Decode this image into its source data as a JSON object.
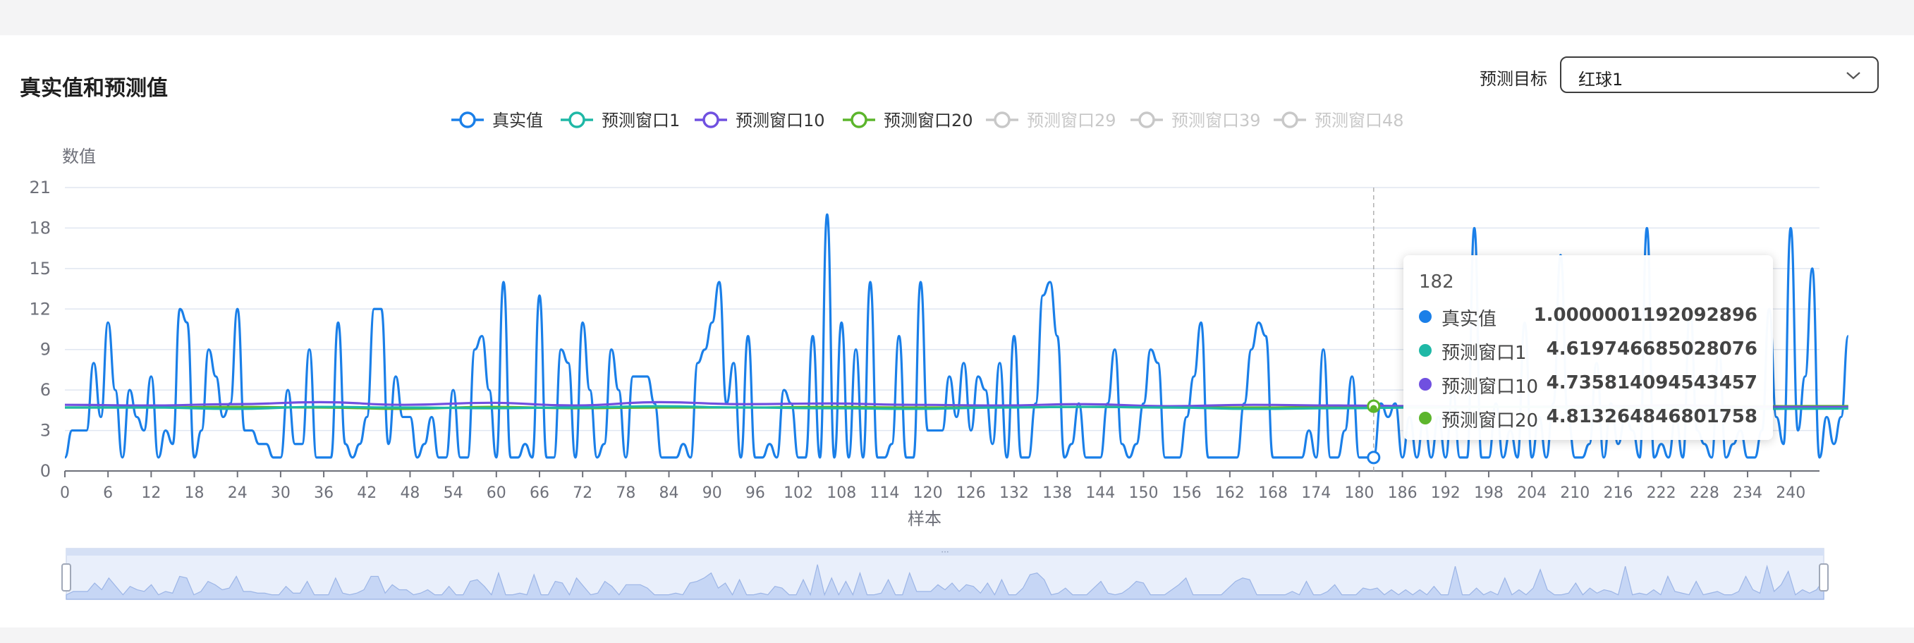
{
  "panel": {
    "title": "真实值和预测值",
    "target_label": "预测目标",
    "target_value": "红球1"
  },
  "tooltip": {
    "header": "182",
    "rows": [
      {
        "name": "真实值",
        "value": "1.0000001192092896",
        "color": "#1a7fe8"
      },
      {
        "name": "预测窗口1",
        "value": "4.619746685028076",
        "color": "#1fb8a6"
      },
      {
        "name": "预测窗口10",
        "value": "4.735814094543457",
        "color": "#7050e0"
      },
      {
        "name": "预测窗口20",
        "value": "4.813264846801758",
        "color": "#5cb52c"
      }
    ]
  },
  "chart_data": {
    "type": "line",
    "xlabel": "样本",
    "ylabel": "数值",
    "ylim": [
      0,
      21
    ],
    "yticks": [
      0,
      3,
      6,
      9,
      12,
      15,
      18,
      21
    ],
    "xlim": [
      0,
      244
    ],
    "xticks": [
      0,
      6,
      12,
      18,
      24,
      30,
      36,
      42,
      48,
      54,
      60,
      66,
      72,
      78,
      84,
      90,
      96,
      102,
      108,
      114,
      120,
      126,
      132,
      138,
      144,
      150,
      156,
      162,
      168,
      174,
      180,
      186,
      192,
      198,
      204,
      210,
      216,
      222,
      228,
      234,
      240
    ],
    "grid": true,
    "legend_position": "top",
    "hover_index": 182,
    "series": [
      {
        "name": "真实值",
        "color": "#1a7fe8",
        "visible": true,
        "values": [
          1,
          3,
          3,
          3,
          8,
          4,
          11,
          6,
          1,
          6,
          4,
          3,
          7,
          1,
          3,
          2,
          12,
          11,
          1,
          3,
          9,
          7,
          4,
          5,
          12,
          3,
          3,
          2,
          2,
          1,
          1,
          6,
          2,
          2,
          9,
          1,
          1,
          1,
          11,
          2,
          1,
          2,
          4,
          12,
          12,
          2,
          7,
          4,
          4,
          1,
          2,
          4,
          1,
          1,
          6,
          1,
          1,
          9,
          10,
          6,
          1,
          14,
          1,
          1,
          2,
          1,
          13,
          1,
          1,
          9,
          8,
          1,
          11,
          6,
          1,
          2,
          9,
          6,
          1,
          7,
          7,
          7,
          5,
          1,
          1,
          1,
          2,
          1,
          8,
          9,
          11,
          14,
          5,
          8,
          1,
          10,
          1,
          1,
          2,
          1,
          6,
          5,
          1,
          1,
          10,
          1,
          19,
          1,
          11,
          1,
          9,
          1,
          14,
          1,
          1,
          2,
          10,
          1,
          1,
          14,
          3,
          3,
          3,
          7,
          4,
          8,
          3,
          7,
          6,
          2,
          8,
          1,
          10,
          1,
          1,
          5,
          13,
          14,
          10,
          1,
          2,
          5,
          1,
          1,
          1,
          5,
          9,
          2,
          1,
          2,
          5,
          9,
          8,
          1,
          1,
          1,
          4,
          7,
          11,
          1,
          1,
          1,
          1,
          1,
          5,
          9,
          11,
          10,
          1,
          1,
          1,
          1,
          1,
          3,
          1,
          9,
          1,
          1,
          3,
          7,
          1,
          1,
          1,
          5,
          4,
          5,
          1,
          4,
          1,
          4,
          1,
          4,
          1,
          6,
          1,
          1,
          18,
          1,
          1,
          5,
          1,
          3,
          1,
          11,
          1,
          4,
          1,
          5,
          16,
          4,
          1,
          1,
          2,
          8,
          1,
          5,
          2,
          4,
          3,
          1,
          18,
          1,
          2,
          1,
          4,
          1,
          12,
          3,
          2,
          1,
          9,
          1,
          2,
          3,
          1,
          1,
          3,
          12,
          4,
          2,
          18,
          3,
          7,
          15,
          1,
          4,
          2,
          4,
          10
        ]
      },
      {
        "name": "预测窗口1",
        "color": "#1fb8a6",
        "visible": true,
        "values": [
          4.7,
          4.7,
          4.6,
          4.75,
          4.7,
          4.65,
          4.7,
          4.8,
          4.7,
          4.65,
          4.6,
          4.7,
          4.75,
          4.7,
          4.6,
          4.65,
          4.7,
          4.75,
          4.7,
          4.65,
          4.6,
          4.62
        ]
      },
      {
        "name": "预测窗口10",
        "color": "#7050e0",
        "visible": true,
        "values": [
          4.9,
          4.85,
          4.95,
          5.1,
          4.9,
          5.05,
          4.85,
          5.1,
          4.95,
          5.0,
          4.9,
          4.85,
          4.95,
          4.8,
          4.9,
          4.85,
          4.8,
          4.75,
          4.8,
          4.85,
          4.75,
          4.74
        ]
      },
      {
        "name": "预测窗口20",
        "color": "#5cb52c",
        "visible": true,
        "values": [
          4.7,
          4.7,
          4.75,
          4.7,
          4.6,
          4.75,
          4.65,
          4.7,
          4.7,
          4.75,
          4.7,
          4.7,
          4.75,
          4.7,
          4.7,
          4.75,
          4.7,
          4.75,
          4.8,
          4.85,
          4.8,
          4.81
        ]
      },
      {
        "name": "预测窗口29",
        "color": "#c8c8c8",
        "visible": false,
        "values": []
      },
      {
        "name": "预测窗口39",
        "color": "#c8c8c8",
        "visible": false,
        "values": []
      },
      {
        "name": "预测窗口48",
        "color": "#c8c8c8",
        "visible": false,
        "values": []
      }
    ]
  }
}
